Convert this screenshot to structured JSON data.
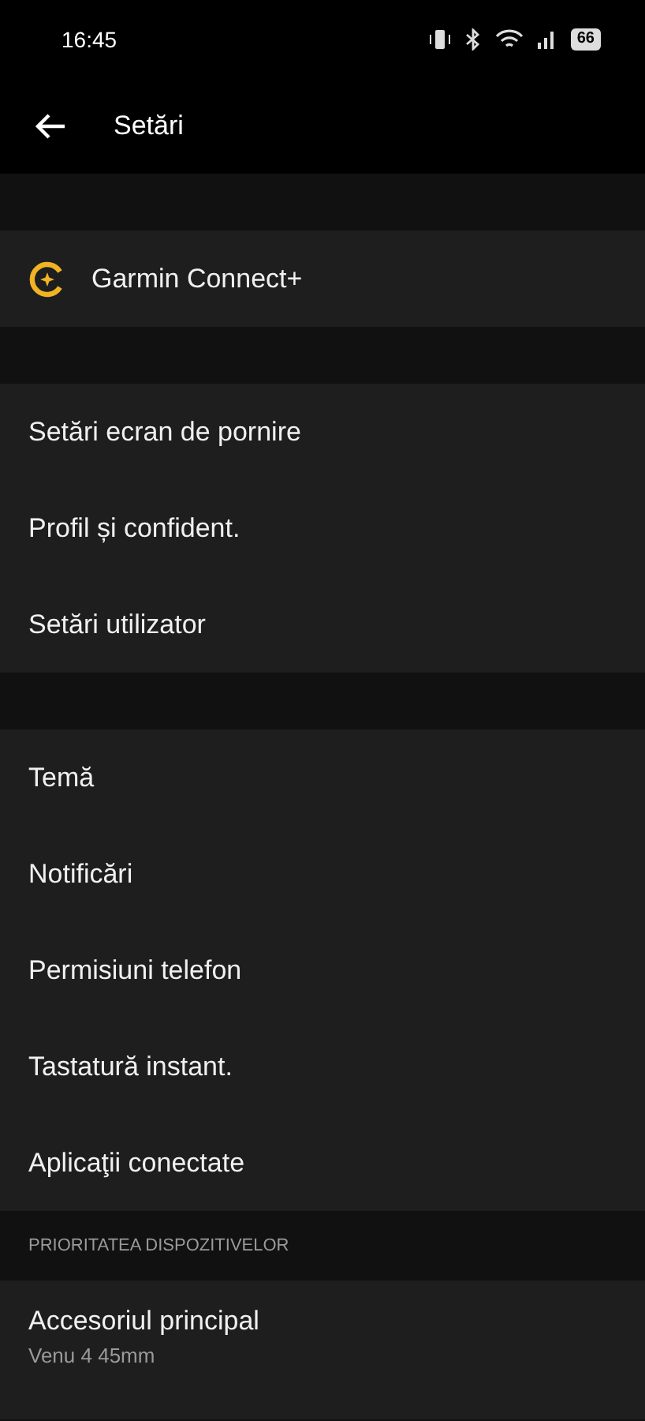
{
  "status_bar": {
    "time": "16:45",
    "battery": "66"
  },
  "app_bar": {
    "title": "Setări"
  },
  "sections": [
    {
      "items": [
        {
          "kind": "subscription",
          "label": "Garmin Connect+"
        }
      ]
    },
    {
      "items": [
        {
          "kind": "plain",
          "label": "Setări ecran de pornire"
        },
        {
          "kind": "plain",
          "label": "Profil și confident."
        },
        {
          "kind": "plain",
          "label": "Setări utilizator"
        }
      ]
    },
    {
      "items": [
        {
          "kind": "plain",
          "label": "Temă"
        },
        {
          "kind": "plain",
          "label": "Notificări"
        },
        {
          "kind": "plain",
          "label": "Permisiuni telefon"
        },
        {
          "kind": "plain",
          "label": "Tastatură instant."
        },
        {
          "kind": "plain",
          "label": "Aplicaţii conectate"
        }
      ]
    },
    {
      "header": "PRIORITATEA DISPOZITIVELOR",
      "items": [
        {
          "kind": "detail",
          "label": "Accesoriul principal",
          "subtitle": "Venu 4 45mm"
        }
      ]
    }
  ]
}
